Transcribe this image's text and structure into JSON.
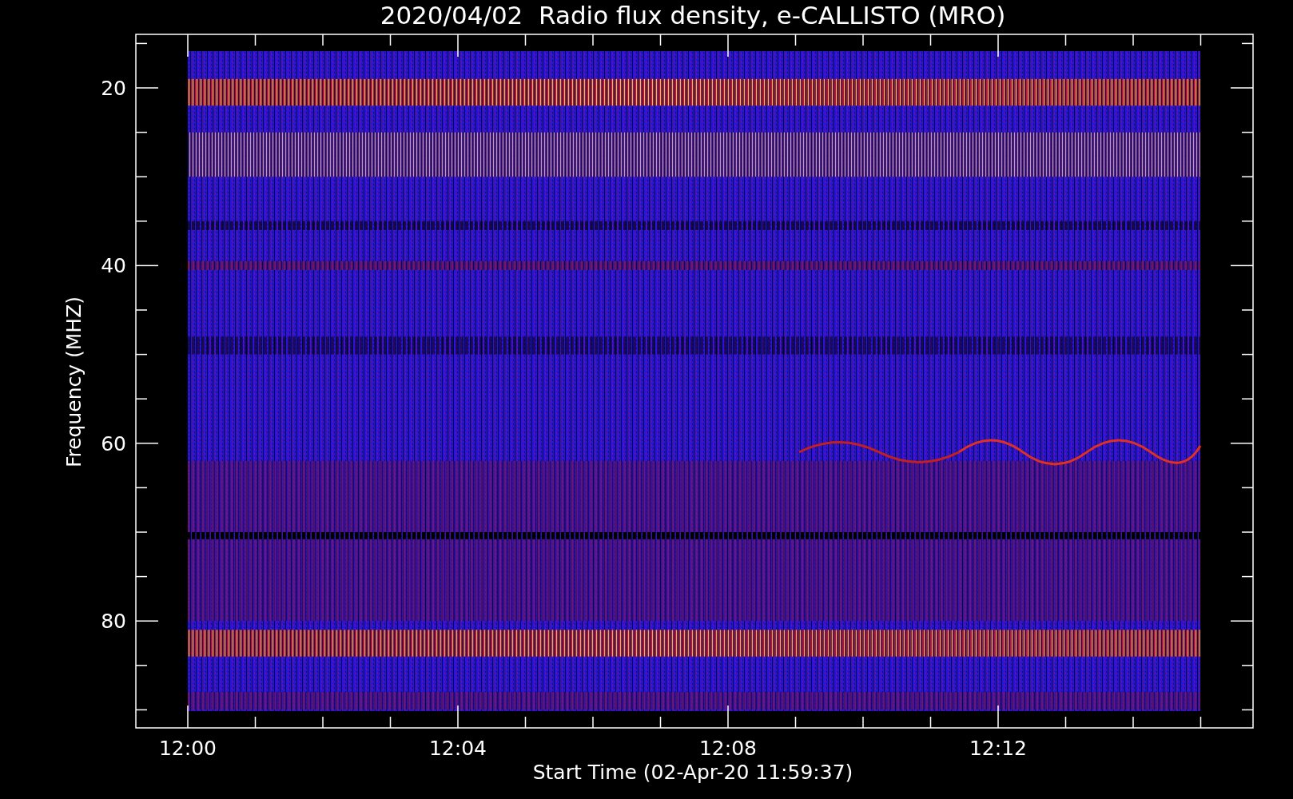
{
  "chart": {
    "title": "2020/04/02  Radio flux density, e-CALLISTO (MRO)",
    "ylabel": "Frequency (MHZ)",
    "xlabel": "Start Time (02-Apr-20 11:59:37)",
    "yticks": [
      "20",
      "40",
      "60",
      "80"
    ],
    "xticks": [
      "12:00",
      "12:04",
      "12:08",
      "12:12"
    ]
  }
}
